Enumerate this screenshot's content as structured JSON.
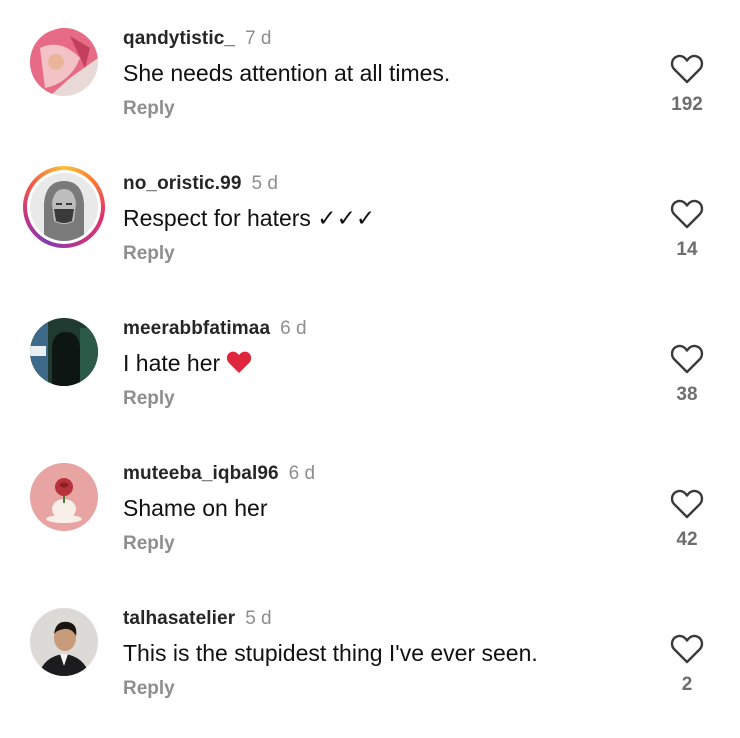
{
  "colors": {
    "username": "#262626",
    "secondary": "#8e8e8e",
    "text": "#111111",
    "like_outline": "#3a3a3a",
    "heart_emoji": "#e0263c"
  },
  "comments": [
    {
      "username": "qandytistic_",
      "time": "7 d",
      "text": "She needs attention at all times.",
      "reply_label": "Reply",
      "likes": "192",
      "avatar_icon": "avatar-photo-pink-fabric"
    },
    {
      "username": "no_oristic.99",
      "time": "5 d",
      "text": "Respect for haters ✓✓✓",
      "reply_label": "Reply",
      "likes": "14",
      "avatar_icon": "avatar-sketch-hijab-with-story-ring"
    },
    {
      "username": "meerabbfatimaa",
      "time": "6 d",
      "text": "I hate her",
      "emoji": "red-heart-emoji",
      "reply_label": "Reply",
      "likes": "38",
      "avatar_icon": "avatar-photo-dark-green"
    },
    {
      "username": "muteeba_iqbal96",
      "time": "6 d",
      "text": "Shame on her",
      "reply_label": "Reply",
      "likes": "42",
      "avatar_icon": "avatar-illustration-pink-rose"
    },
    {
      "username": "talhasatelier",
      "time": "5 d",
      "text": "This is the stupidest thing I've ever seen.",
      "reply_label": "Reply",
      "likes": "2",
      "avatar_icon": "avatar-photo-man-suit"
    }
  ]
}
